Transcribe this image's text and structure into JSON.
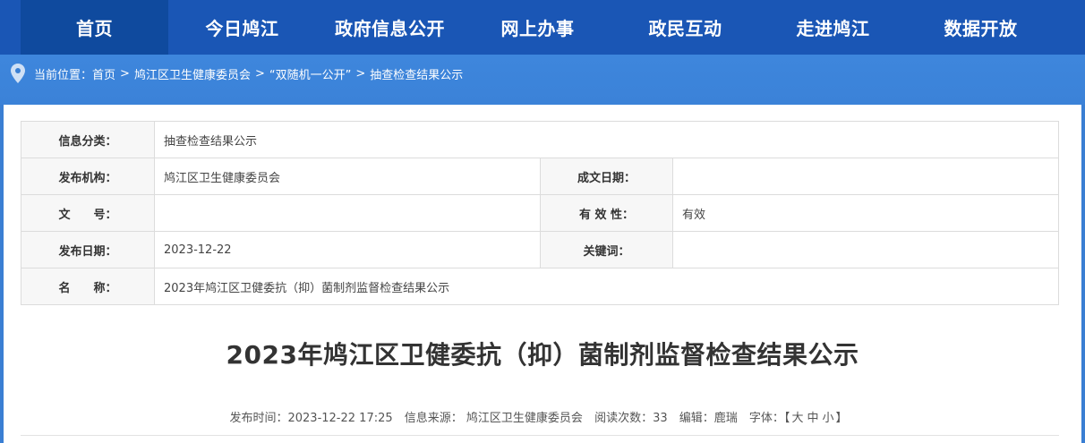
{
  "nav": {
    "items": [
      {
        "label": "首页"
      },
      {
        "label": "今日鸠江"
      },
      {
        "label": "政府信息公开"
      },
      {
        "label": "网上办事"
      },
      {
        "label": "政民互动"
      },
      {
        "label": "走进鸠江"
      },
      {
        "label": "数据开放"
      }
    ]
  },
  "breadcrumb": {
    "prefix": "当前位置：",
    "items": [
      "首页",
      "鸠江区卫生健康委员会",
      "“双随机一公开”",
      "抽查检查结果公示"
    ],
    "separator": ">"
  },
  "info": {
    "category_label": "信息分类：",
    "category_value": "抽查检查结果公示",
    "publisher_label": "发布机构：",
    "publisher_value": "鸠江区卫生健康委员会",
    "written_date_label": "成文日期：",
    "written_date_value": "",
    "doc_no_label": "文　　号：",
    "doc_no_value": "",
    "validity_label": "有 效 性：",
    "validity_value": "有效",
    "publish_date_label": "发布日期：",
    "publish_date_value": "2023-12-22",
    "keywords_label": "关键词：",
    "keywords_value": "",
    "name_label": "名　　称：",
    "name_value": "2023年鸠江区卫健委抗（抑）菌制剂监督检查结果公示"
  },
  "article": {
    "title": "2023年鸠江区卫健委抗（抑）菌制剂监督检查结果公示",
    "publish_time": "发布时间：2023-12-22 17:25",
    "source": "信息来源： 鸠江区卫生健康委员会",
    "views": "阅读次数：33",
    "editor": "编辑：鹿瑞",
    "font_label": "字体：",
    "font_open": "【",
    "font_large": "大",
    "font_medium": "中",
    "font_small": "小",
    "font_close": "】"
  },
  "colors": {
    "nav_bg": "#1a56b5",
    "nav_active": "#0f4a9e",
    "band_bg": "#3a7fd3"
  }
}
